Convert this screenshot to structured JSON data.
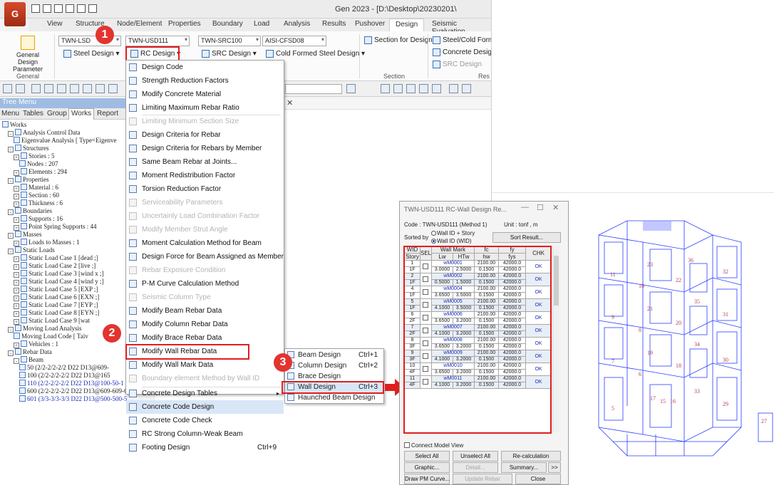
{
  "app": {
    "logo": "G",
    "title": "Gen 2023 - [D:\\Desktop\\20230201\\",
    "tabs": [
      "View",
      "Structure",
      "Node/Element",
      "Properties",
      "Boundary",
      "Load",
      "Analysis",
      "Results",
      "Pushover",
      "Design",
      "Seismic Evaluation"
    ],
    "active_tab": "Design"
  },
  "ribbon": {
    "general_design_parameter": "General Design Parameter",
    "group_general": "General",
    "steel_code": "TWN-LSD",
    "steel_design": "Steel Design",
    "rc_code": "TWN-USD111",
    "rc_design": "RC Design",
    "src_code": "TWN-SRC100",
    "src_design": "SRC Design",
    "cfs_code": "AISI-CFSD08",
    "cfs_design": "Cold Formed Steel Design",
    "section_for_design": "Section for Design",
    "group_section": "Section",
    "steel_cold_form": "Steel/Cold Form",
    "concrete_design": "Concrete Design",
    "src_design_right": "SRC Design",
    "group_res": "Res"
  },
  "tree": {
    "header": "Tree Menu",
    "tabs": [
      "Menu",
      "Tables",
      "Group",
      "Works",
      "Report"
    ],
    "active_tab": "Works",
    "items": [
      {
        "text": "Works",
        "level": 0,
        "box": ""
      },
      {
        "text": "Analysis Control Data",
        "level": 1,
        "box": "-"
      },
      {
        "text": "Eigenvalue Analysis [ Type=Eigenve",
        "level": 2,
        "box": ""
      },
      {
        "text": "Structures",
        "level": 1,
        "box": "-"
      },
      {
        "text": "Stories : 5",
        "level": 2,
        "box": "+"
      },
      {
        "text": "Nodes : 207",
        "level": 3,
        "box": ""
      },
      {
        "text": "Elements : 294",
        "level": 2,
        "box": "+"
      },
      {
        "text": "Properties",
        "level": 1,
        "box": "-"
      },
      {
        "text": "Material : 6",
        "level": 2,
        "box": "+"
      },
      {
        "text": "Section : 60",
        "level": 2,
        "box": "+"
      },
      {
        "text": "Thickness : 6",
        "level": 2,
        "box": "+"
      },
      {
        "text": "Boundaries",
        "level": 1,
        "box": "-"
      },
      {
        "text": "Supports : 16",
        "level": 2,
        "box": "+"
      },
      {
        "text": "Point Spring Supports : 44",
        "level": 2,
        "box": "+"
      },
      {
        "text": "Masses",
        "level": 1,
        "box": "-"
      },
      {
        "text": "Loads to Masses : 1",
        "level": 2,
        "box": "+"
      },
      {
        "text": "Static Loads",
        "level": 1,
        "box": "-"
      },
      {
        "text": "Static Load Case 1 [dead ;]",
        "level": 2,
        "box": "+"
      },
      {
        "text": "Static Load Case 2 [live ;]",
        "level": 2,
        "box": "+"
      },
      {
        "text": "Static Load Case 3 [wind x ;]",
        "level": 2,
        "box": "+"
      },
      {
        "text": "Static Load Case 4 [wind y ;]",
        "level": 2,
        "box": "+"
      },
      {
        "text": "Static Load Case 5 [EXP ;]",
        "level": 2,
        "box": "+"
      },
      {
        "text": "Static Load Case 6 [EXN ;]",
        "level": 2,
        "box": "+"
      },
      {
        "text": "Static Load Case 7 [EYP ;]",
        "level": 2,
        "box": "+"
      },
      {
        "text": "Static Load Case 8 [EYN ;]",
        "level": 2,
        "box": "+"
      },
      {
        "text": "Static Load Case 9 [wat",
        "level": 2,
        "box": "+"
      },
      {
        "text": "Moving Load Analysis",
        "level": 1,
        "box": "-"
      },
      {
        "text": "Moving Load Code [ Taiv",
        "level": 2,
        "box": ""
      },
      {
        "text": "Vehicles : 1",
        "level": 2,
        "box": "+"
      },
      {
        "text": "Rebar Data",
        "level": 1,
        "box": "-"
      },
      {
        "text": "Beam",
        "level": 2,
        "box": "-"
      },
      {
        "text": "50 (2/2-2/2-2/2 D22 D13@609-",
        "level": 3,
        "box": ""
      },
      {
        "text": "100 (2/2-2/2-2/2 D22 D13@165",
        "level": 3,
        "box": ""
      },
      {
        "text": "110 (2/2-2/2-2/2 D22 D13@100-50-1",
        "level": 3,
        "box": "",
        "blue": true
      },
      {
        "text": "600 (2/2-2/2-2/2 D22 D13@609-609-6",
        "level": 3,
        "box": ""
      },
      {
        "text": "601 (3/3-3/3-3/3 D22 D13@500-500-5",
        "level": 3,
        "box": "",
        "blue": true
      }
    ]
  },
  "menu": {
    "items": [
      {
        "label": "Design Code",
        "disabled": false
      },
      {
        "label": "Strength Reduction Factors",
        "disabled": false
      },
      {
        "label": "Modify Concrete Material",
        "disabled": false
      },
      {
        "label": "Limiting Maximum Rebar Ratio",
        "disabled": false
      },
      {
        "label": "Limiting Minimum Section Size",
        "disabled": true
      },
      {
        "label": "Design Criteria for Rebar",
        "disabled": false
      },
      {
        "label": "Design Criteria for Rebars by Member",
        "disabled": false
      },
      {
        "label": "Same Beam Rebar at Joints...",
        "disabled": false
      },
      {
        "label": "Moment Redistribution Factor",
        "disabled": false
      },
      {
        "label": "Torsion Reduction Factor",
        "disabled": false
      },
      {
        "label": "Serviceability Parameters",
        "disabled": true
      },
      {
        "label": "Uncertainly Load Combination Factor",
        "disabled": true
      },
      {
        "label": "Modify Member Strut Angle",
        "disabled": true
      },
      {
        "label": "Moment Calculation Method for Beam",
        "disabled": false
      },
      {
        "label": "Design Force for Beam Assigned as Member",
        "disabled": false
      },
      {
        "label": "Rebar Exposure Condition",
        "disabled": true
      },
      {
        "label": "P-M Curve Calculation Method",
        "disabled": false
      },
      {
        "label": "Seismic Column Type",
        "disabled": true
      },
      {
        "label": "Modify Beam Rebar Data",
        "disabled": false
      },
      {
        "label": "Modify Column Rebar Data",
        "disabled": false
      },
      {
        "label": "Modify Brace Rebar Data",
        "disabled": false
      },
      {
        "label": "Modify Wall Rebar Data",
        "disabled": false
      },
      {
        "label": "Modify Wall Mark Data",
        "disabled": false
      },
      {
        "label": "Boundary element Method by Wall ID",
        "disabled": true
      },
      {
        "label": "Concrete Design Tables",
        "disabled": false,
        "arrow": "▸"
      },
      {
        "label": "Concrete Code Design",
        "disabled": false,
        "hot": true
      },
      {
        "label": "Concrete Code Check",
        "disabled": false
      },
      {
        "label": "RC Strong Column-Weak Beam",
        "disabled": false
      },
      {
        "label": "Footing Design",
        "disabled": false,
        "shortcut": "Ctrl+9"
      }
    ]
  },
  "submenu": {
    "items": [
      {
        "label": "Beam Design",
        "shortcut": "Ctrl+1"
      },
      {
        "label": "Column Design",
        "shortcut": "Ctrl+2"
      },
      {
        "label": "Brace Design",
        "shortcut": ""
      },
      {
        "label": "Wall Design",
        "shortcut": "Ctrl+3",
        "hot": true
      },
      {
        "label": "Haunched Beam Design",
        "shortcut": ""
      }
    ]
  },
  "badges": {
    "b1": "1",
    "b2": "2",
    "b3": "3"
  },
  "dialog": {
    "title": "TWN-USD111 RC-Wall Design Re...",
    "ctrl_min": "—",
    "ctrl_max": "☐",
    "ctrl_close": "✕",
    "code_line": "Code : TWN-USD111 (Method 1)",
    "unit_line": "Unit :  tonf  ,   m",
    "sorted_by": "Sorted by",
    "radio1": "Wall ID + Story",
    "radio2": "Wall ID (WID)",
    "sort_result": "Sort Result...",
    "headers": {
      "wid": "WID",
      "sel": "SEL",
      "wall_mark": "Wall Mark",
      "fc": "fc",
      "fy": "fy",
      "chk": "CHK",
      "story": "Story",
      "lw": "Lw",
      "htw": "HTw",
      "hw": "hw",
      "fys": "fys"
    },
    "rows": [
      {
        "wid": "1",
        "story": "1F",
        "mark": "wM0001",
        "lw": "3.0000",
        "htw": "2.5000",
        "fc": "2100.00",
        "fy": "42000.0",
        "hw": "0.1500",
        "fys": "42000.0",
        "chk": "OK"
      },
      {
        "wid": "2",
        "story": "1F",
        "mark": "wM0002",
        "lw": "0.5000",
        "htw": "1.5000",
        "fc": "2100.00",
        "fy": "42000.0",
        "hw": "0.1500",
        "fys": "42000.0",
        "chk": "OK"
      },
      {
        "wid": "4",
        "story": "1F",
        "mark": "wM0004",
        "lw": "3.6500",
        "htw": "3.5000",
        "fc": "2100.00",
        "fy": "42000.0",
        "hw": "0.1500",
        "fys": "42000.0",
        "chk": "OK"
      },
      {
        "wid": "5",
        "story": "1F",
        "mark": "wM0005",
        "lw": "4.1000",
        "htw": "3.5000",
        "fc": "2100.00",
        "fy": "42000.0",
        "hw": "0.1500",
        "fys": "42000.0",
        "chk": "OK"
      },
      {
        "wid": "6",
        "story": "2F",
        "mark": "wM0006",
        "lw": "3.6500",
        "htw": "3.2000",
        "fc": "2100.00",
        "fy": "42000.0",
        "hw": "0.1500",
        "fys": "42000.0",
        "chk": "OK"
      },
      {
        "wid": "7",
        "story": "2F",
        "mark": "wM0007",
        "lw": "4.1000",
        "htw": "3.2000",
        "fc": "2100.00",
        "fy": "42000.0",
        "hw": "0.1500",
        "fys": "42000.0",
        "chk": "OK"
      },
      {
        "wid": "8",
        "story": "3F",
        "mark": "wM0008",
        "lw": "3.6500",
        "htw": "3.2000",
        "fc": "2100.00",
        "fy": "42000.0",
        "hw": "0.1500",
        "fys": "42000.0",
        "chk": "OK"
      },
      {
        "wid": "9",
        "story": "3F",
        "mark": "wM0009",
        "lw": "4.1000",
        "htw": "3.2000",
        "fc": "2100.00",
        "fy": "42000.0",
        "hw": "0.1500",
        "fys": "42000.0",
        "chk": "OK"
      },
      {
        "wid": "10",
        "story": "4F",
        "mark": "wM0010",
        "lw": "3.6500",
        "htw": "3.2000",
        "fc": "2100.00",
        "fy": "42000.0",
        "hw": "0.1500",
        "fys": "42000.0",
        "chk": "OK"
      },
      {
        "wid": "11",
        "story": "4F",
        "mark": "wM0011",
        "lw": "4.1000",
        "htw": "3.2000",
        "fc": "2100.00",
        "fy": "42000.0",
        "hw": "0.1500",
        "fys": "42000.0",
        "chk": "OK"
      }
    ],
    "connect_model_view": "Connect Model View",
    "buttons": {
      "select_all": "Select All",
      "unselect_all": "Unselect All",
      "recalculation": "Re-calculation",
      "graphic": "Graphic...",
      "detail": "Detail...",
      "summary": "Summary...",
      "more": ">>",
      "draw_pm": "Draw PM Curve...",
      "update_rebar": "Update Rebar",
      "close": "Close"
    }
  },
  "model": {
    "labels": [
      "36",
      "23",
      "22",
      "32",
      "11",
      "10",
      "35",
      "21",
      "20",
      "31",
      "9",
      "8",
      "34",
      "19",
      "18",
      "30",
      "7",
      "6",
      "33",
      "17",
      "16",
      "5",
      "15",
      "29",
      "27"
    ]
  },
  "colors": {
    "highlight": "#e01e1e",
    "badge": "#e3342f",
    "model_line": "#2a3cff",
    "model_label": "#b0405c"
  }
}
